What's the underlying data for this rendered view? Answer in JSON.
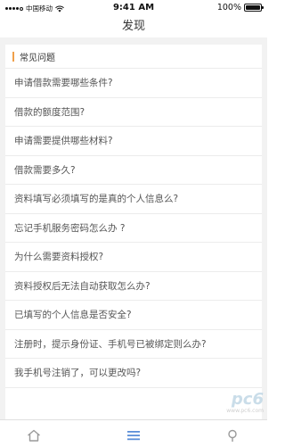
{
  "status_bar": {
    "carrier": "中国移动",
    "time": "9:41 AM",
    "battery": "100%"
  },
  "header": {
    "title": "发现"
  },
  "faq": {
    "section_title": "常见问题",
    "items": [
      "申请借款需要哪些条件?",
      "借款的额度范围?",
      "申请需要提供哪些材料?",
      "借款需要多久?",
      "资料填写必须填写的是真的个人信息么?",
      "忘记手机服务密码怎么办 ?",
      "为什么需要资料授权?",
      "资料授权后无法自动获取怎么办?",
      "已填写的个人信息是否安全?",
      "注册时，提示身份证、手机号已被绑定则么办?",
      "我手机号注销了，可以更改吗?"
    ]
  },
  "watermark": {
    "logo": "pc6",
    "site": "www.pc6.com"
  },
  "tabbar": {
    "icons": [
      "home-icon",
      "list-icon",
      "location-pin-icon"
    ],
    "active_color": "#5b8fd8",
    "inactive_color": "#9a9a9a"
  },
  "colors": {
    "accent": "#f0a04b",
    "background": "#f2f2f2"
  }
}
